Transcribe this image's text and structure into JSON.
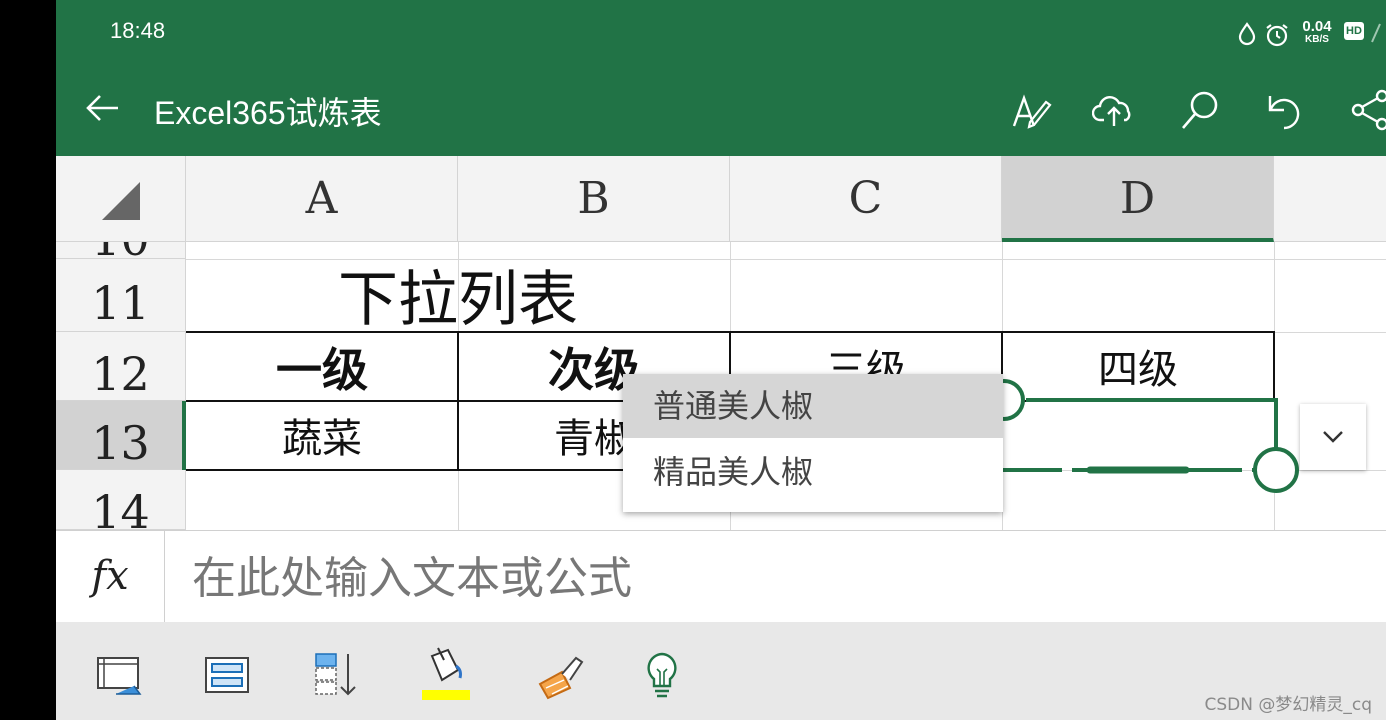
{
  "status_bar": {
    "time": "18:48",
    "net_speed": "0.04",
    "net_unit": "KB/S",
    "hd": "HD"
  },
  "app_bar": {
    "title": "Excel365试炼表"
  },
  "columns": [
    "A",
    "B",
    "C",
    "D"
  ],
  "rows": {
    "r10": "10",
    "r11": "11",
    "r12": "12",
    "r13": "13",
    "r14": "14"
  },
  "cells": {
    "a11_title": "下拉列表",
    "a12": "一级",
    "b12": "次级",
    "c12": "三级",
    "d12": "四级",
    "a13": "蔬菜",
    "b13": "青椒"
  },
  "dropdown": {
    "items": [
      "普通美人椒",
      "精品美人椒"
    ]
  },
  "formula_bar": {
    "fx": "fx",
    "placeholder": "在此处输入文本或公式"
  },
  "watermark": "CSDN @梦幻精灵_cq",
  "colors": {
    "accent": "#217346",
    "fill_color": "#ffff00"
  }
}
